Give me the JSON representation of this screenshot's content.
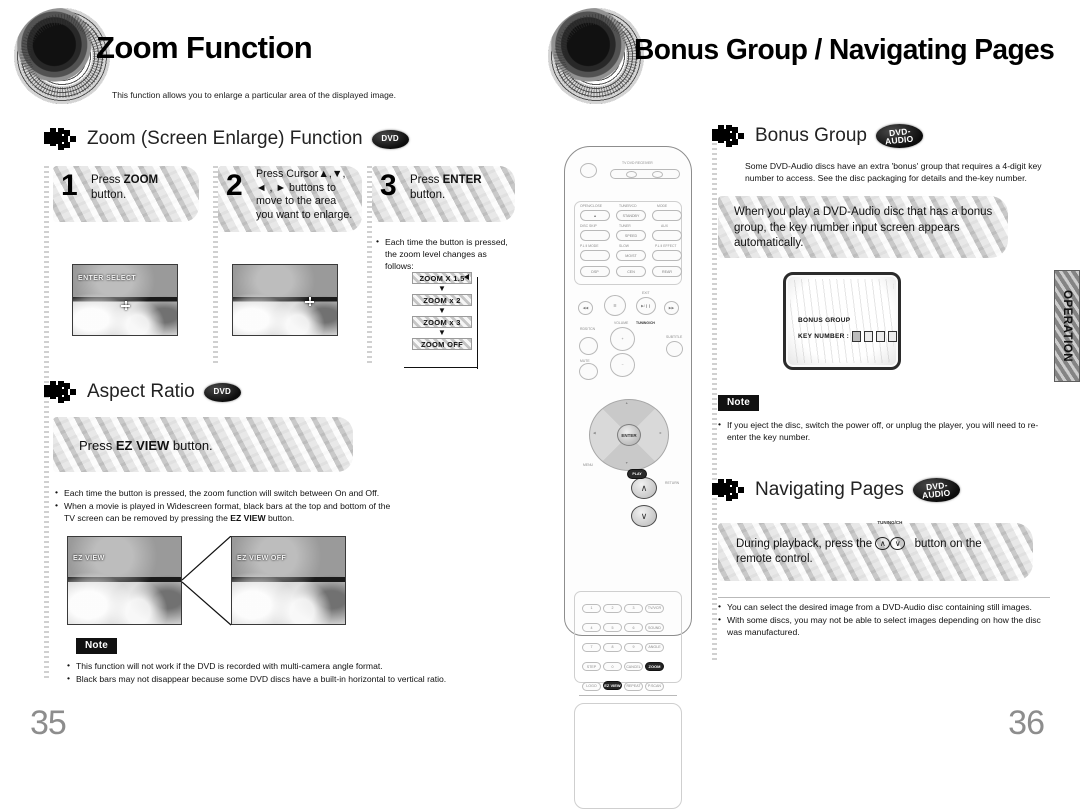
{
  "document": {
    "type": "dvd-player-user-manual-spread",
    "side_tab_label": "OPERATION"
  },
  "left_page": {
    "folio": "35",
    "chapter_title": "Zoom Function",
    "chapter_subtitle": "This function allows you to enlarge a particular area of the displayed image.",
    "sections": [
      {
        "id": "zoom-screen-enlarge",
        "title": "Zoom (Screen Enlarge) Function",
        "badge": "DVD",
        "steps": [
          {
            "number": "1",
            "text_parts": [
              "Press ",
              "ZOOM",
              " button."
            ],
            "plain": "Press ZOOM button."
          },
          {
            "number": "2",
            "plain": "Press Cursor ▲,▼, ◄ , ► buttons to move to the area you want to enlarge."
          },
          {
            "number": "3",
            "plain": "Press ENTER button."
          }
        ],
        "screens": [
          {
            "osd": "ENTER SELECT"
          },
          {
            "osd": ""
          }
        ],
        "note_bullet": "Each time the button is pressed, the zoom level changes as follows:",
        "zoom_levels": [
          "ZOOM X 1.5",
          "ZOOM x 2",
          "ZOOM x 3",
          "ZOOM OFF"
        ]
      },
      {
        "id": "aspect-ratio",
        "title": "Aspect Ratio",
        "badge": "DVD",
        "banner": "Press EZ VIEW button.",
        "banner_bold": "EZ VIEW",
        "bullets": [
          "Each time the button is pressed, the zoom function will switch between On and Off.",
          "When a movie is played in Widescreen format, black bars at the top and bottom of the TV screen can be removed by pressing the EZ VIEW button."
        ],
        "compare_screens": [
          {
            "osd": "EZ VIEW"
          },
          {
            "osd": "EZ VIEW OFF"
          }
        ],
        "note_tag": "Note",
        "note_bullets": [
          "This function will not work if the DVD is recorded with multi-camera angle format.",
          "Black bars may not disappear because some DVD discs have a built-in horizontal to vertical ratio."
        ]
      }
    ]
  },
  "right_page": {
    "folio": "36",
    "chapter_title": "Bonus Group / Navigating Pages",
    "sections": [
      {
        "id": "bonus-group",
        "title": "Bonus Group",
        "badge_line1": "DVD-",
        "badge_line2": "AUDIO",
        "intro": "Some DVD-Audio discs have an extra 'bonus' group that requires a 4-digit key number to access. See the disc packaging for details and the-key number.",
        "banner": "When you play a DVD-Audio disc that has a bonus group, the key number input screen appears automatically.",
        "tv_screen": {
          "title": "BONUS GROUP",
          "field_label": "KEY NUMBER :",
          "digits": [
            "",
            "",
            "",
            ""
          ]
        },
        "note_tag": "Note",
        "note_bullets": [
          "If you eject the disc, switch the power off, or unplug the player, you will need to re-enter the key number."
        ]
      },
      {
        "id": "navigating-pages",
        "title": "Navigating Pages",
        "badge_line1": "DVD-",
        "badge_line2": "AUDIO",
        "banner_before": "During playback, press the",
        "banner_button_label": "TUNING/CH",
        "banner_after": "button on the remote control.",
        "bullets": [
          "You can select the desired image from a DVD-Audio disc containing still images.",
          "With some discs, you may not be able to select images depending on how the disc was manufactured."
        ]
      }
    ],
    "remote": {
      "highlighted_buttons": [
        "ZOOM",
        "EZ VIEW"
      ],
      "dpad_center_label": "ENTER",
      "tuning_label": "TUNING/CH"
    }
  }
}
